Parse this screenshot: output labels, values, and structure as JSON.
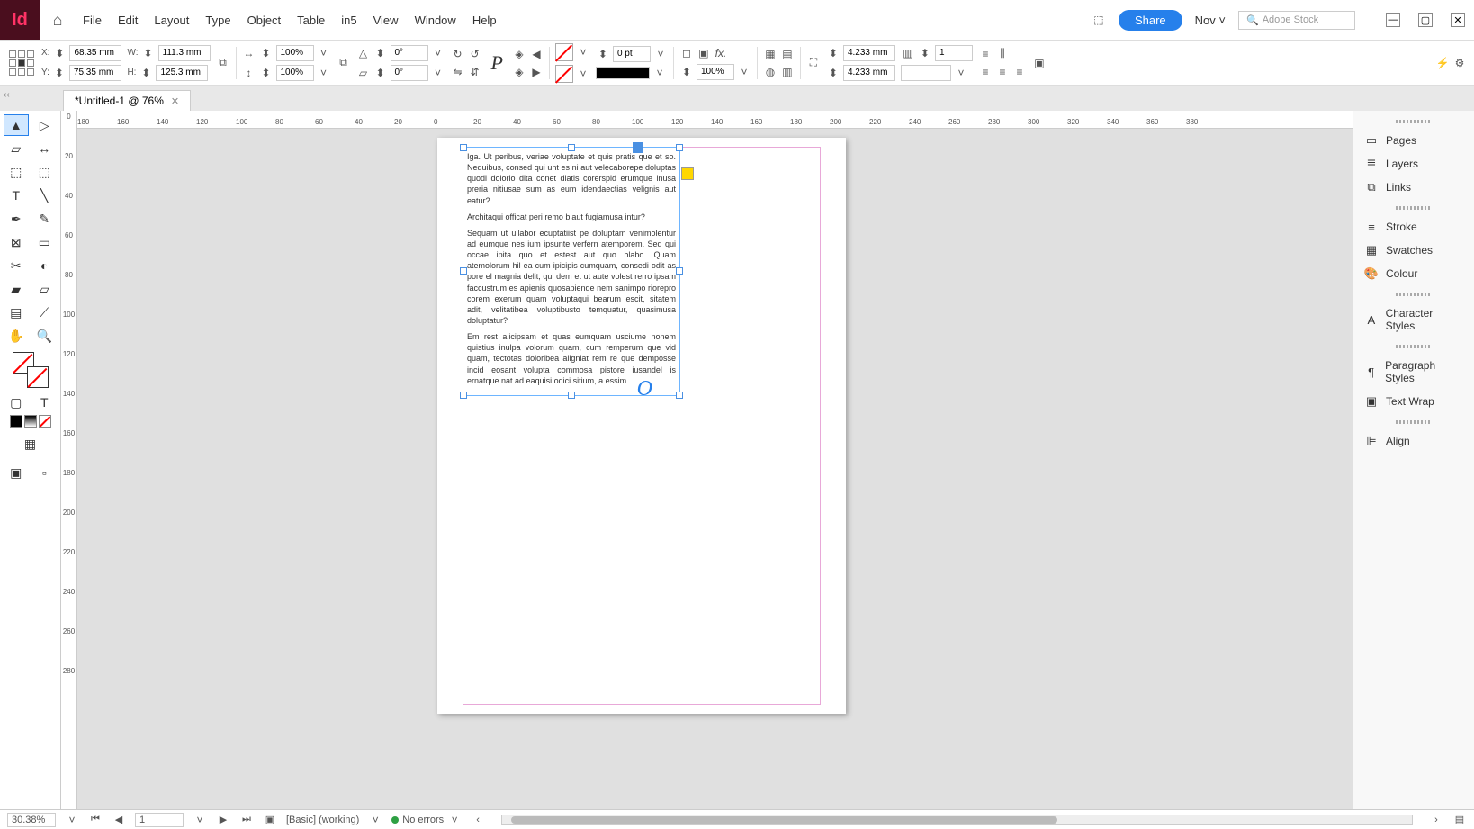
{
  "app": {
    "logo_text": "Id"
  },
  "menu": [
    "File",
    "Edit",
    "Layout",
    "Type",
    "Object",
    "Table",
    "in5",
    "View",
    "Window",
    "Help"
  ],
  "titlebar": {
    "share": "Share",
    "workspace": "Nov",
    "search_placeholder": "Adobe Stock"
  },
  "controls": {
    "x": "68.35 mm",
    "y": "75.35 mm",
    "w": "111.3 mm",
    "h": "125.3 mm",
    "scale_x": "100%",
    "scale_y": "100%",
    "rotation": "0°",
    "shear": "0°",
    "stroke_weight": "0 pt",
    "opacity": "100%",
    "fit_w": "4.233 mm",
    "fit_h": "4.233 mm",
    "columns": "1"
  },
  "tab": {
    "title": "*Untitled-1 @ 76%"
  },
  "hruler_marks": [
    -180,
    -160,
    -140,
    -120,
    -100,
    -80,
    -60,
    -40,
    -20,
    0,
    20,
    40,
    60,
    80,
    100,
    120,
    140,
    160,
    180,
    200,
    220,
    240,
    260,
    280,
    300,
    320,
    340,
    360,
    380
  ],
  "vruler_marks": [
    "0",
    "20",
    "40",
    "60",
    "80",
    "100",
    "120",
    "140",
    "160",
    "180",
    "200",
    "220",
    "240",
    "260",
    "280"
  ],
  "document_text": {
    "p1": "Iga. Ut peribus, veriae voluptate et quis pratis que et so. Nequibus, consed qui unt es ni aut velecaborepe doluptas quodi dolorio dita conet diatis corerspid erumque inusa preria nitiusae sum as eum idendaectias velignis aut eatur?",
    "p2": "Architaqui officat peri remo blaut fugiamusa intur?",
    "p3": "Sequam ut ullabor ecuptatiist pe doluptam venimolentur ad eumque nes ium ipsunte verfern atemporem. Sed qui occae ipita quo et estest aut quo blabo. Quam atemolorum hil ea cum ipicipis cumquam, consedi odit as pore el magnia delit, qui dem et ut aute volest rerro ipsam faccustrum es apienis quosapiende nem sanimpo riorepro corem exerum quam voluptaqui bearum escit, sitatem adit, velitatibea voluptibusto temquatur, quasimusa doluptatur?",
    "p4": "Em rest alicipsam et quas eumquam usciume nonem quistius inulpa volorum quam, cum remperum que vid quam, tectotas doloribea aligniat rem re que demposse incid eosant volupta commosa pistore iusandel is ernatque nat ad eaquisi odici sitium, a essim"
  },
  "right_panels": {
    "group1": [
      "Pages",
      "Layers",
      "Links"
    ],
    "group2": [
      "Stroke",
      "Swatches",
      "Colour"
    ],
    "group3": [
      "Character Styles"
    ],
    "group4": [
      "Paragraph Styles",
      "Text Wrap"
    ],
    "group5": [
      "Align"
    ]
  },
  "status": {
    "zoom": "30.38%",
    "page": "1",
    "profile": "[Basic] (working)",
    "errors": "No errors"
  }
}
